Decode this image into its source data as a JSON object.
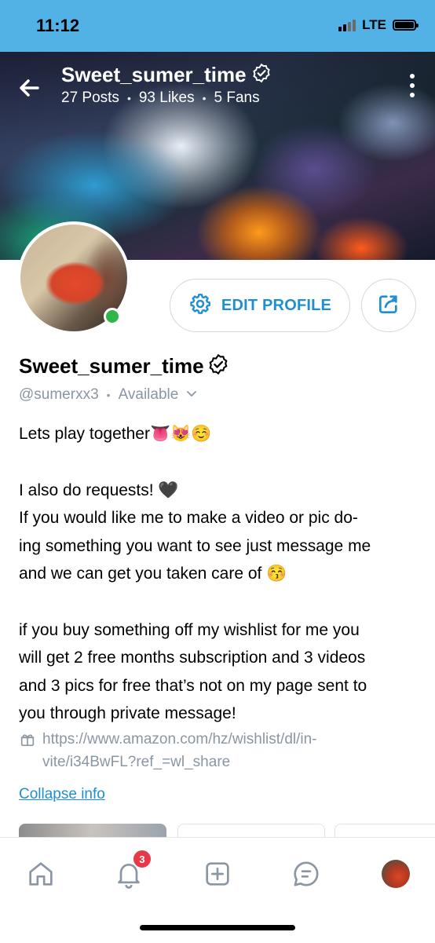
{
  "status_bar": {
    "time": "11:12",
    "network": "LTE"
  },
  "header": {
    "name": "Sweet_sumer_time",
    "posts": "27 Posts",
    "likes": "93 Likes",
    "fans": "5 Fans"
  },
  "actions": {
    "edit_profile": "EDIT PROFILE"
  },
  "profile": {
    "name": "Sweet_sumer_time",
    "handle": "@sumerxx3",
    "status": "Available",
    "bio": [
      "Lets play together👅😻☺️",
      "I also do requests! 🖤\nIf you would like me to make a video or pic do-\ning something you want to see just message me\nand we can get you taken care of 😚",
      "if you buy something off my wishlist for me you\nwill get 2 free months subscription and 3 videos\nand 3 pics for free that’s not on my page sent to\nyou through private message!"
    ],
    "link": "https://www.amazon.com/hz/wishlist/dl/in-\nvite/i34BwFL?ref_=wl_share",
    "collapse_label": "Collapse info"
  },
  "bottom_nav": {
    "notifications_badge": "3"
  },
  "colors": {
    "accent": "#1e8fd2",
    "status_bar": "#52b2e6",
    "online": "#2fb54a",
    "badge": "#e8394a"
  }
}
